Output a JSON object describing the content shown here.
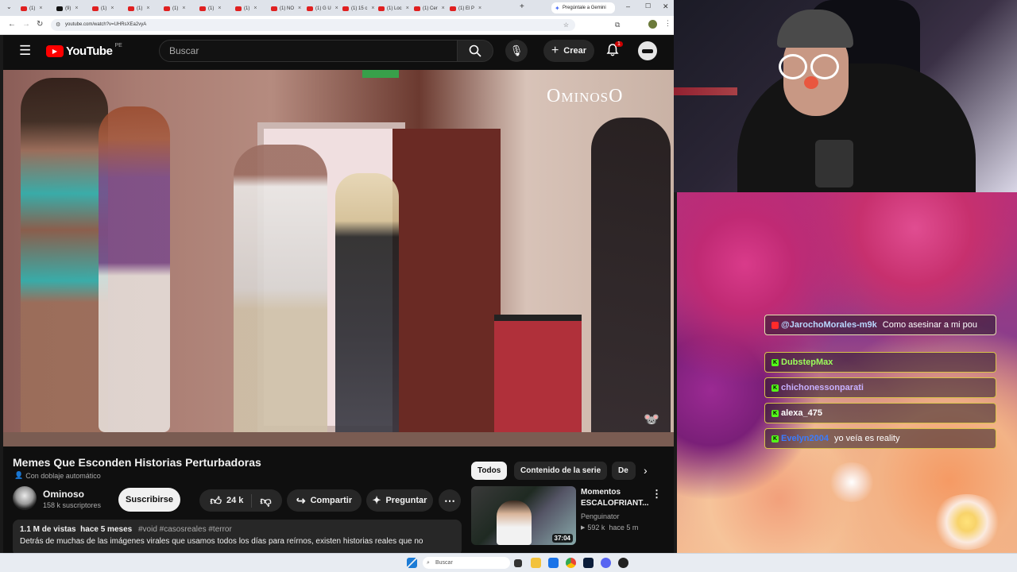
{
  "browser": {
    "tabs": [
      "(1)",
      "(9)",
      "(1)",
      "(1)",
      "(1)",
      "(1)",
      "(1)",
      "(1) NO",
      "(1) G U",
      "(1) 15 c",
      "(1) Loc",
      "(1) Cer",
      "(1) El P"
    ],
    "gemini_tab": "Pregúntale a Gemini",
    "url": "youtube.com/watch?v=UHRsXEa2vyA"
  },
  "youtube": {
    "logo_text": "YouTube",
    "region": "PE",
    "search_placeholder": "Buscar",
    "create_label": "Crear",
    "notif_count": "1",
    "video_watermark": "OminosO",
    "title": "Memes Que Esconden Historias Perturbadoras",
    "dub_label": "Con doblaje automático",
    "channel": {
      "name": "Ominoso",
      "subscribers": "158 k suscriptores",
      "subscribe_label": "Suscribirse"
    },
    "actions": {
      "likes": "24 k",
      "share": "Compartir",
      "ask": "Preguntar"
    },
    "description": {
      "stats": "1.1 M de vistas  hace 5 meses",
      "tags": "#void #casosreales #terror",
      "text": "Detrás de muchas de las imágenes virales que usamos todos los días para reírnos, existen historias reales que no"
    },
    "chips": [
      "Todos",
      "Contenido de la serie",
      "De"
    ],
    "recommended": {
      "title_line1": "Momentos",
      "title_line2": "ESCALOFRIANT...",
      "channel": "Penguinator",
      "meta": "592 k  hace 5 m",
      "duration": "37:04"
    }
  },
  "chat": {
    "messages": [
      {
        "user": "@JarochoMorales-m9k",
        "text": "Como asesinar a mi pou",
        "user_color": "#b9d7ff"
      },
      {
        "user": "DubstepMax",
        "text": "",
        "user_color": "#9cff5a"
      },
      {
        "user": "chichonessonparati",
        "text": "",
        "user_color": "#c8b0ff"
      },
      {
        "user": "alexa_475",
        "text": "",
        "user_color": "#ffffff"
      },
      {
        "user": "Evelyn2004",
        "text": "yo veía es reality",
        "user_color": "#3a7bff"
      }
    ]
  },
  "taskbar": {
    "search_placeholder": "Buscar"
  }
}
